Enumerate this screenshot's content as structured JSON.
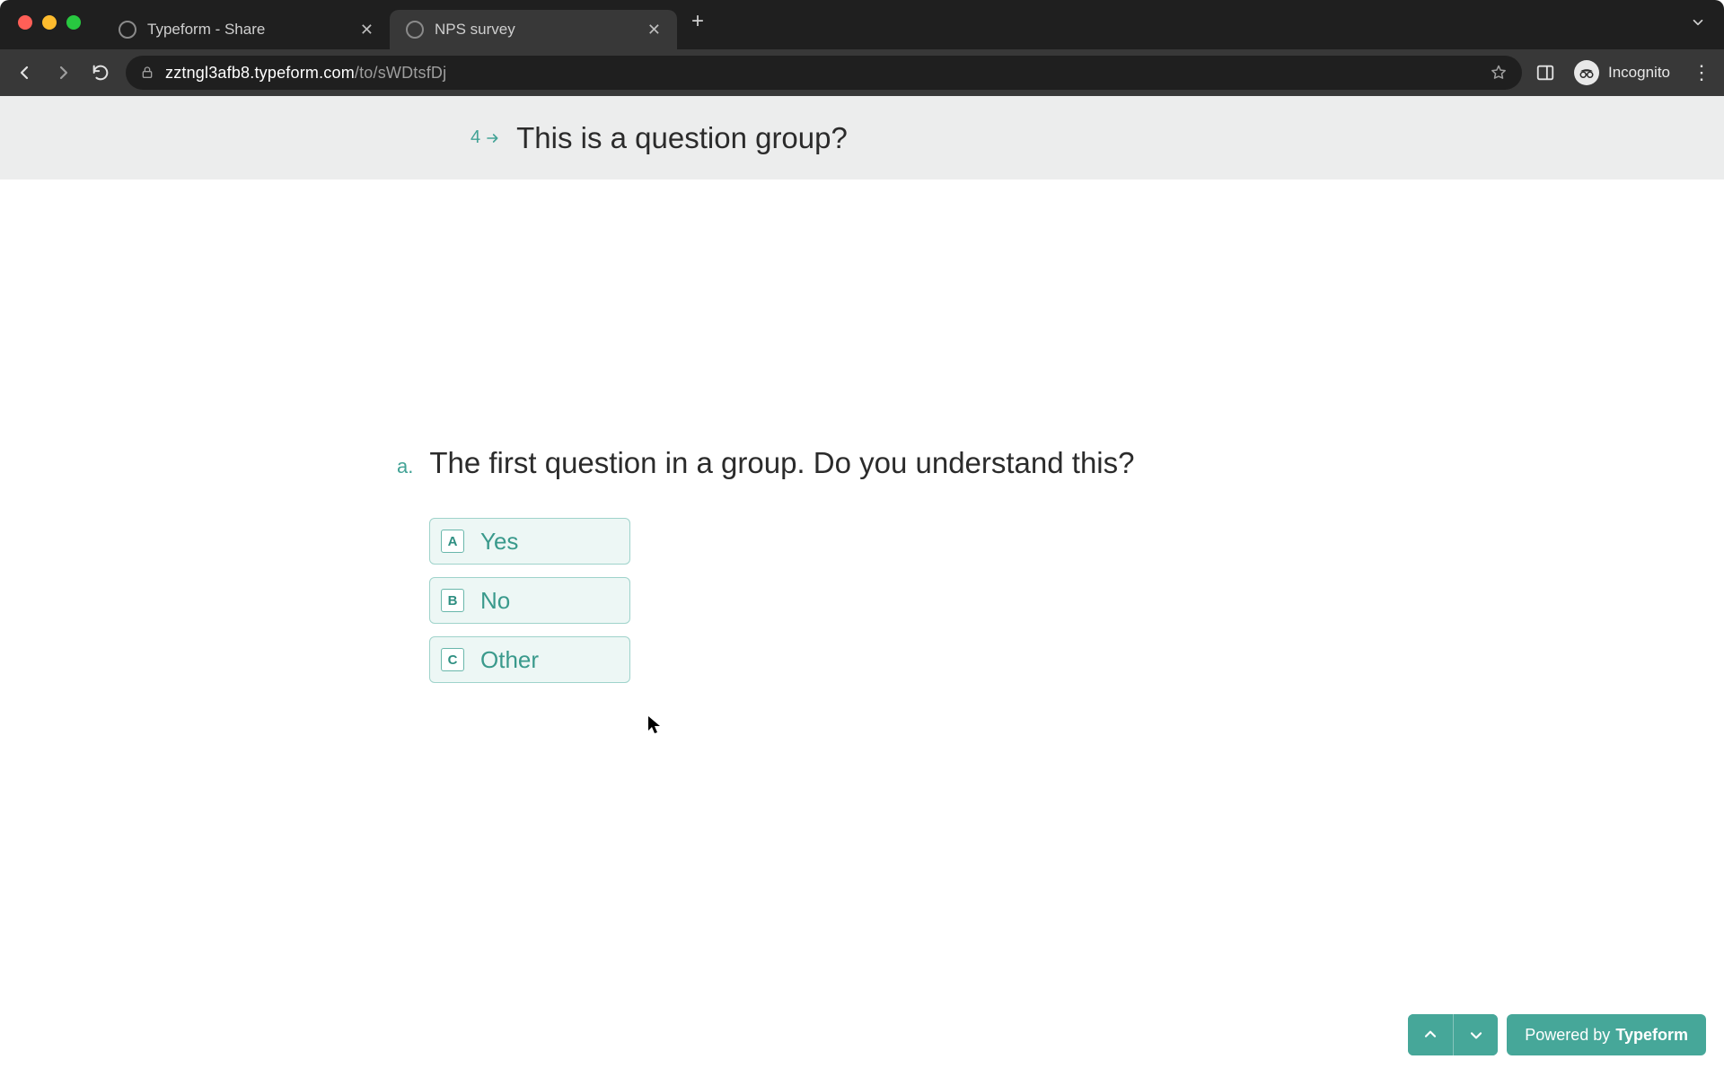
{
  "browser": {
    "tabs": [
      {
        "title": "Typeform - Share",
        "active": false
      },
      {
        "title": "NPS survey",
        "active": true
      }
    ],
    "url_domain": "zztngl3afb8.typeform.com",
    "url_path": "/to/sWDtsfDj",
    "incognito_label": "Incognito"
  },
  "survey": {
    "group_number": "4",
    "group_title": "This is a question group?",
    "question_marker": "a.",
    "question_text": "The first question in a group. Do you understand this?",
    "choices": [
      {
        "key": "A",
        "label": "Yes"
      },
      {
        "key": "B",
        "label": "No"
      },
      {
        "key": "C",
        "label": "Other"
      }
    ]
  },
  "footer": {
    "powered_prefix": "Powered by ",
    "powered_brand": "Typeform"
  },
  "colors": {
    "accent": "#46a799",
    "accent_light": "#edf7f5",
    "choice_border": "#9fd3cb",
    "text": "#2b2b2b"
  }
}
